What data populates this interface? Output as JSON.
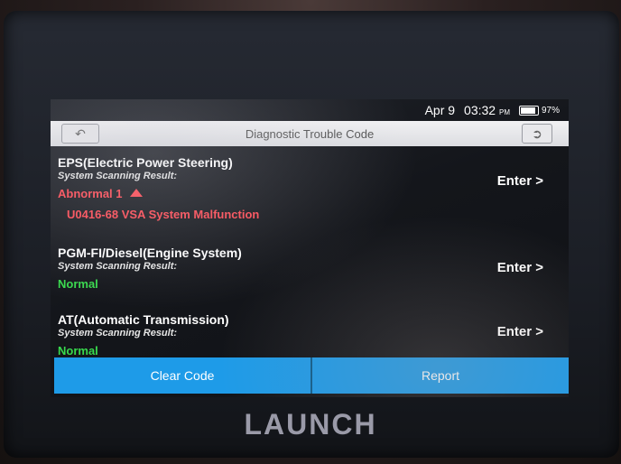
{
  "status_bar": {
    "date": "Apr 9",
    "time": "03:32",
    "ampm": "PM",
    "battery_percent": "97%",
    "battery_level": 0.97
  },
  "title_bar": {
    "title": "Diagnostic Trouble Code",
    "back_icon": "back-arrow-icon",
    "exit_icon": "exit-icon"
  },
  "systems": [
    {
      "name": "EPS(Electric Power Steering)",
      "result_label": "System Scanning Result:",
      "status": "Abnormal 1",
      "status_color": "#ff4b55",
      "expand_icon": "triangle-up-icon",
      "dtc": "U0416-68 VSA System Malfunction",
      "enter": "Enter >"
    },
    {
      "name": "PGM-FI/Diesel(Engine System)",
      "result_label": "System Scanning Result:",
      "status": "Normal",
      "status_color": "#38d94d",
      "enter": "Enter >"
    },
    {
      "name": "AT(Automatic Transmission)",
      "result_label": "System Scanning Result:",
      "status": "Normal",
      "status_color": "#38d94d",
      "enter": "Enter >"
    }
  ],
  "actions": {
    "clear_code": "Clear Code",
    "report": "Report"
  },
  "brand": "LAUNCH",
  "colors": {
    "accent": "#1e9be8",
    "error": "#ff4b55",
    "ok": "#38d94d"
  }
}
